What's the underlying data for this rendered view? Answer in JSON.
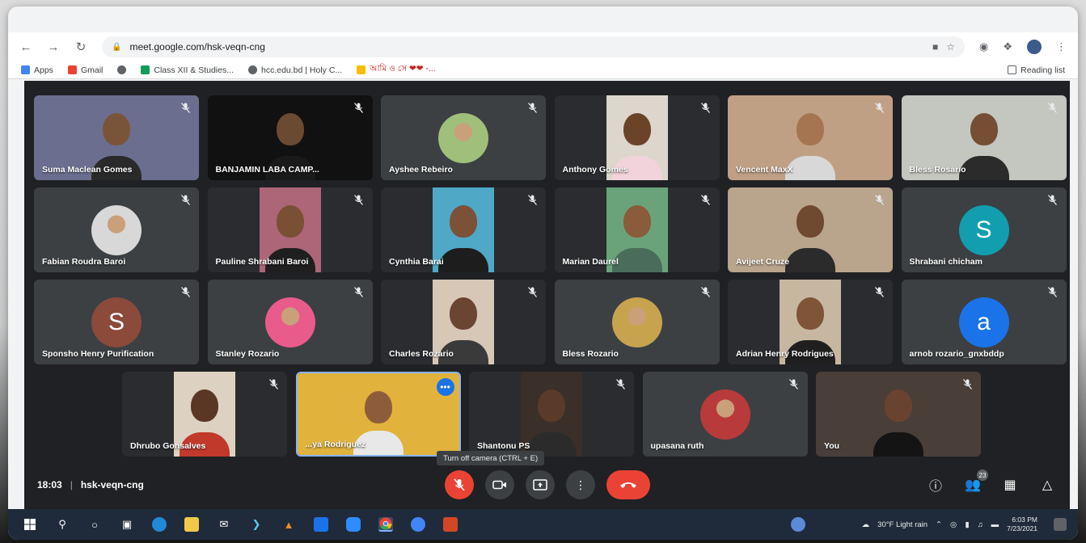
{
  "browser": {
    "url": "meet.google.com/hsk-veqn-cng",
    "bookmarks": [
      {
        "label": "Apps",
        "color": "#4285f4"
      },
      {
        "label": "Gmail",
        "color": "#ea4335"
      },
      {
        "label": "",
        "color": "#5f6368"
      },
      {
        "label": "Class XII & Studies...",
        "color": "#0f9d58"
      },
      {
        "label": "hcc.edu.bd | Holy C...",
        "color": "#5f6368"
      },
      {
        "label": "আমি ও সে ❤❤ -...",
        "color": "#fbbc04"
      }
    ],
    "reading_list": "Reading list"
  },
  "participants": [
    {
      "name": "Suma Maclean Gomes",
      "kind": "video",
      "bg": "#6b6e8f",
      "skin": "#7a5438",
      "shirt": "#2a2a2a",
      "full": true
    },
    {
      "name": "BANJAMIN LABA CAMP...",
      "kind": "video",
      "bg": "#111111",
      "skin": "#6a4a30",
      "shirt": "#1a1a1a",
      "full": true
    },
    {
      "name": "Ayshee Rebeiro",
      "kind": "photo",
      "color": "#9fbf7a"
    },
    {
      "name": "Anthony Gomes",
      "kind": "video",
      "bg": "#dcd6cc",
      "skin": "#6a4328",
      "shirt": "#f2d3dc"
    },
    {
      "name": "Vencent MaxX",
      "kind": "video",
      "bg": "#c0a085",
      "skin": "#a57551",
      "shirt": "#d8d8d8",
      "full": true
    },
    {
      "name": "Bless Rosario",
      "kind": "video",
      "bg": "#c4c6c0",
      "skin": "#754e33",
      "shirt": "#2b2b2b",
      "full": true
    },
    {
      "name": "Fabian Roudra Baroi",
      "kind": "photo",
      "color": "#d8d8d8"
    },
    {
      "name": "Pauline Shrabani Baroi",
      "kind": "video",
      "bg": "#ad6578",
      "skin": "#7a5035",
      "shirt": "#1f1f1f"
    },
    {
      "name": "Cynthia Barai",
      "kind": "video",
      "bg": "#4fa8c6",
      "skin": "#7d5038",
      "shirt": "#1d1d1d"
    },
    {
      "name": "Marian Daurel",
      "kind": "video",
      "bg": "#6aa37a",
      "skin": "#8a5c3c",
      "shirt": "#496d5a"
    },
    {
      "name": "Avijeet Cruze",
      "kind": "video",
      "bg": "#b9a48c",
      "skin": "#6f4a30",
      "shirt": "#2b2b2b",
      "full": true
    },
    {
      "name": "Shrabani chicham",
      "kind": "initial",
      "initial": "S",
      "color": "#129eaf"
    },
    {
      "name": "Sponsho Henry Purification",
      "kind": "initial",
      "initial": "S",
      "color": "#8b4a3a"
    },
    {
      "name": "Stanley Rozario",
      "kind": "photo",
      "color": "#e95b8b"
    },
    {
      "name": "Charles Rozario",
      "kind": "video",
      "bg": "#d7c7b6",
      "skin": "#6a4532",
      "shirt": "#3a3a3a"
    },
    {
      "name": "Bless Rozario",
      "kind": "photo",
      "color": "#c7a34d"
    },
    {
      "name": "Adrian Henry Rodrigues",
      "kind": "video",
      "bg": "#c7b7a1",
      "skin": "#805437",
      "shirt": "#1f1f1f"
    },
    {
      "name": "arnob rozario_gnxbddp",
      "kind": "initial",
      "initial": "a",
      "color": "#1a73e8"
    },
    {
      "name": "Dhrubo Gonsalves",
      "kind": "video",
      "bg": "#ddd2c2",
      "skin": "#5a3724",
      "shirt": "#c0392b"
    },
    {
      "name": "...ya Rodriguez",
      "kind": "video",
      "bg": "#e1b23c",
      "skin": "#8d5d3b",
      "shirt": "#e8e8e8",
      "full": true,
      "active": true
    },
    {
      "name": "Shantonu PS",
      "kind": "video",
      "bg": "#3a2f29",
      "skin": "#5a3a28",
      "shirt": "#2b2b2b"
    },
    {
      "name": "upasana ruth",
      "kind": "photo",
      "color": "#b83a3a"
    },
    {
      "name": "You",
      "kind": "video",
      "bg": "#4a3e38",
      "skin": "#6a4330",
      "shirt": "#141414",
      "full": true
    }
  ],
  "tooltip": "Turn off camera (CTRL + E)",
  "meeting": {
    "time": "18:03",
    "separator": "|",
    "code": "hsk-veqn-cng"
  },
  "people_count": "23",
  "taskbar": {
    "weather": "30°F  Light rain",
    "time": "6:03 PM",
    "date": "7/23/2021"
  }
}
